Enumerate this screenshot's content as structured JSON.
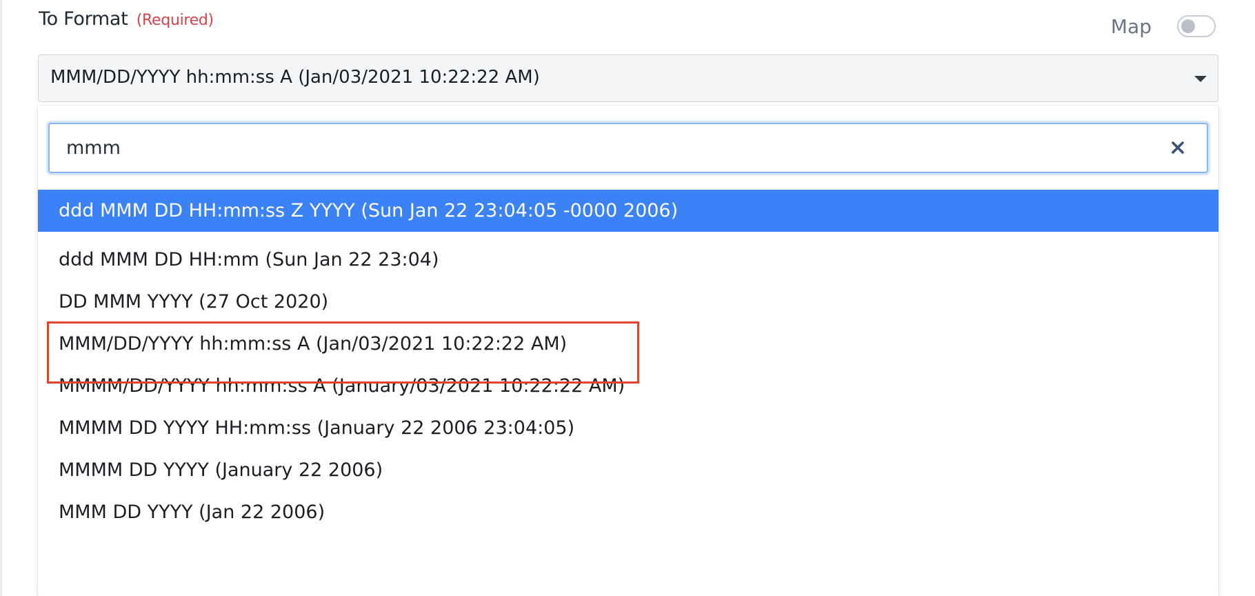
{
  "field": {
    "label": "To Format",
    "required": "(Required)"
  },
  "map_toggle": {
    "label": "Map",
    "state": "off"
  },
  "select": {
    "value": "MMM/DD/YYYY hh:mm:ss A (Jan/03/2021 10:22:22 AM)",
    "caret_icon": "caret-down-icon"
  },
  "search": {
    "value": "mmm",
    "clear_icon": "close-icon"
  },
  "options": [
    {
      "label": "ddd MMM DD HH:mm:ss Z YYYY (Sun Jan 22 23:04:05 -0000 2006)"
    },
    {
      "label": "ddd MMM DD HH:mm (Sun Jan 22 23:04)"
    },
    {
      "label": "DD MMM YYYY (27 Oct 2020)"
    },
    {
      "label": "MMM/DD/YYYY hh:mm:ss A (Jan/03/2021 10:22:22 AM)"
    },
    {
      "label": "MMMM/DD/YYYY hh:mm:ss A (January/03/2021 10:22:22 AM)"
    },
    {
      "label": "MMMM DD YYYY HH:mm:ss (January 22 2006 23:04:05)"
    },
    {
      "label": "MMMM DD YYYY (January 22 2006)"
    },
    {
      "label": "MMM DD YYYY (Jan 22 2006)"
    }
  ],
  "colors": {
    "highlight": "#3b82f6",
    "required": "#d0454c",
    "annotation": "#e0432d",
    "focus_border": "#86b4f7"
  }
}
